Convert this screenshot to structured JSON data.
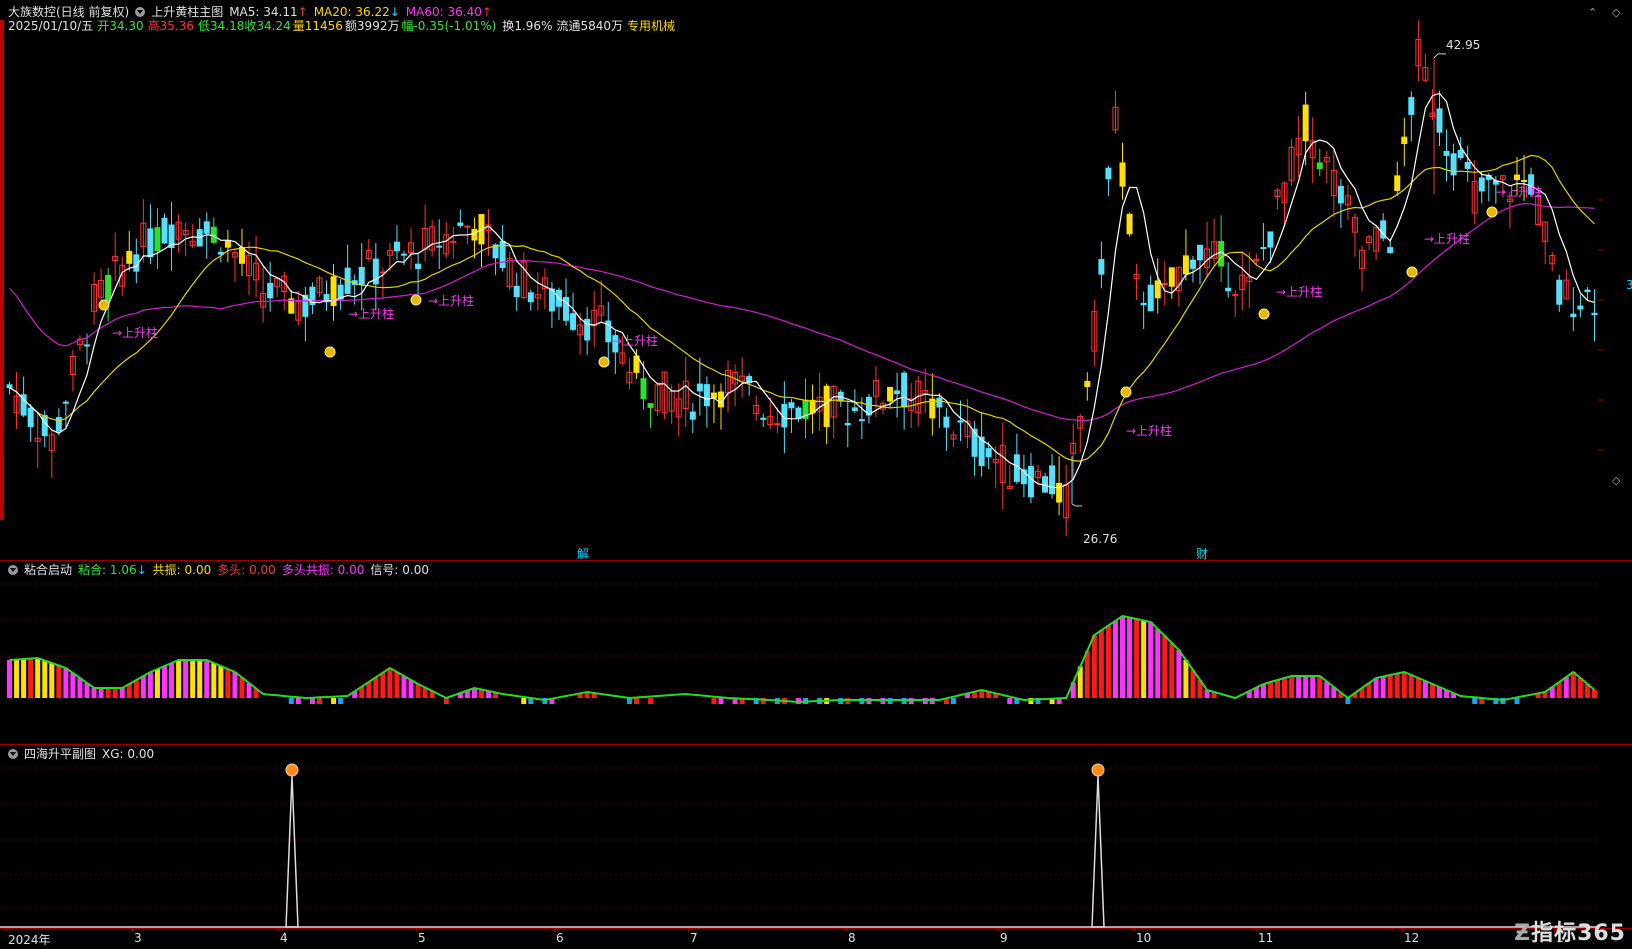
{
  "main_panel": {
    "stock_title": "大族数控(日线 前复权)",
    "indicator_name": "上升黄柱主图",
    "ma5_label": "MA5: 34.11",
    "ma5_arrow": "↑",
    "ma20_label": "MA20: 36.22",
    "ma20_arrow": "↓",
    "ma60_label": "MA60: 36.40",
    "ma60_arrow": "↑",
    "date": "2025/01/10/五",
    "open_label": "开",
    "open_value": "34.30",
    "high_label": "高",
    "high_value": "35.36",
    "low_label": "低",
    "low_value": "34.18",
    "close_label": "收",
    "close_value": "34.24",
    "volume_label": "量",
    "volume_value": "11456",
    "amount": "额3992万",
    "change": "幅-0.35(-1.01%)",
    "turnover": "换1.96%",
    "float": "流通5840万",
    "sector": "专用机械",
    "max_price": "42.95",
    "min_price": "26.76",
    "signal_text": "→上升柱",
    "event_mark_1": "解",
    "event_mark_2": "财",
    "right_price_partial": "3"
  },
  "sub_panel_1": {
    "name": "粘合启动",
    "nianhe_label": "粘合: 1.06",
    "nianhe_arrow": "↓",
    "gongzhen_label": "共振: 0.00",
    "duotou_label": "多头: 0.00",
    "duotou_gongzhen_label": "多头共振: 0.00",
    "xinhao_label": "信号: 0.00"
  },
  "sub_panel_2": {
    "name": "四海升平副图",
    "xg_label": "XG: 0.00"
  },
  "x_axis": {
    "labels": [
      "2024年",
      "3",
      "4",
      "5",
      "6",
      "7",
      "8",
      "9",
      "10",
      "11",
      "12",
      "1"
    ]
  },
  "watermark": "指标365",
  "colors": {
    "up": "#ff3333",
    "down": "#55e0ff",
    "yellow": "#ffe000",
    "green_bar": "#2ee02e",
    "ma5": "#ffffff",
    "ma20": "#e6d300",
    "ma60": "#d21ed2",
    "panel_border": "#9b0000"
  },
  "chart_data": {
    "type": "candlestick",
    "series": [
      {
        "name": "MA5",
        "values": [
          34.11
        ]
      },
      {
        "name": "MA20",
        "values": [
          36.22
        ]
      },
      {
        "name": "MA60",
        "values": [
          36.4
        ]
      }
    ],
    "last_bar": {
      "date": "2025/01/10",
      "open": 34.3,
      "high": 35.36,
      "low": 34.18,
      "close": 34.24
    },
    "period_high": 42.95,
    "period_low": 26.76,
    "x_ticks": [
      "2024年",
      "3",
      "4",
      "5",
      "6",
      "7",
      "8",
      "9",
      "10",
      "11",
      "12",
      "1"
    ]
  }
}
